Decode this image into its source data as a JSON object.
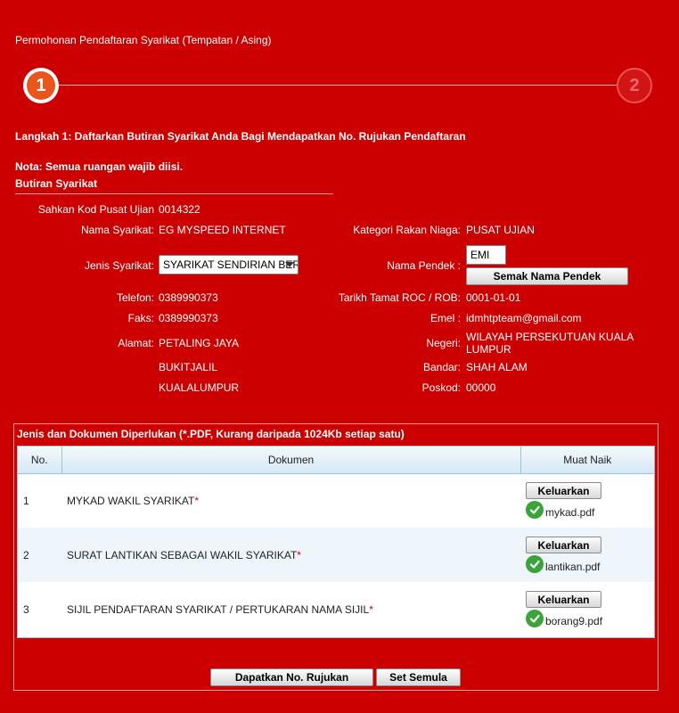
{
  "page": {
    "title": "Permohonan Pendaftaran Syarikat (Tempatan / Asing)"
  },
  "stepper": {
    "step1": "1",
    "step2": "2"
  },
  "heading": {
    "step": "Langkah 1: Daftarkan Butiran Syarikat Anda Bagi Mendapatkan No. Rujukan Pendaftaran",
    "note": "Nota: Semua ruangan wajib diisi.",
    "section": "Butiran Syarikat"
  },
  "form": {
    "kod_label": "Sahkan Kod Pusat Ujian",
    "kod_value": "0014322",
    "nama_label": "Nama Syarikat:",
    "nama_value": "EG MYSPEED INTERNET",
    "kategori_label": "Kategori Rakan Niaga:",
    "kategori_value": "PUSAT UJIAN",
    "jenis_label": "Jenis Syarikat:",
    "jenis_value": "SYARIKAT SENDIRIAN BERHAD",
    "pendek_label": "Nama Pendek :",
    "pendek_value": "EMI",
    "semak_button": "Semak Nama Pendek",
    "telefon_label": "Telefon:",
    "telefon_value": "0389990373",
    "roc_label": "Tarikh Tamat ROC / ROB:",
    "roc_value": "0001-01-01",
    "faks_label": "Faks:",
    "faks_value": "0389990373",
    "emel_label": "Emel :",
    "emel_value": "idmhtpteam@gmail.com",
    "alamat_label": "Alamat:",
    "alamat_line1": "PETALING JAYA",
    "alamat_line2": "BUKITJALIL",
    "alamat_line3": "KUALALUMPUR",
    "negeri_label": "Negeri:",
    "negeri_value_1": "WILAYAH PERSEKUTUAN KUALA",
    "negeri_value_2": "LUMPUR",
    "bandar_label": "Bandar:",
    "bandar_value": "SHAH ALAM",
    "poskod_label": "Poskod:",
    "poskod_value": "00000"
  },
  "documents": {
    "heading": "Jenis dan Dokumen Diperlukan (*.PDF, Kurang daripada 1024Kb setiap satu)",
    "columns": [
      "No.",
      "Dokumen",
      "Muat Naik"
    ],
    "rows": [
      {
        "no": "1",
        "name": "MYKAD WAKIL SYARIKAT",
        "required": "*",
        "button": "Keluarkan",
        "file": "mykad.pdf"
      },
      {
        "no": "2",
        "name": "SURAT LANTIKAN SEBAGAI WAKIL SYARIKAT",
        "required": "*",
        "button": "Keluarkan",
        "file": "lantikan.pdf"
      },
      {
        "no": "3",
        "name": "SIJIL PENDAFTARAN SYARIKAT / PERTUKARAN NAMA SIJIL",
        "required": "*",
        "button": "Keluarkan",
        "file": "borang9.pdf"
      }
    ]
  },
  "actions": {
    "get_reference": "Dapatkan No. Rujukan",
    "reset": "Set Semula"
  },
  "colors": {
    "background": "#cc0000",
    "step_active": "#e8561c",
    "check": "#3aa33a"
  }
}
